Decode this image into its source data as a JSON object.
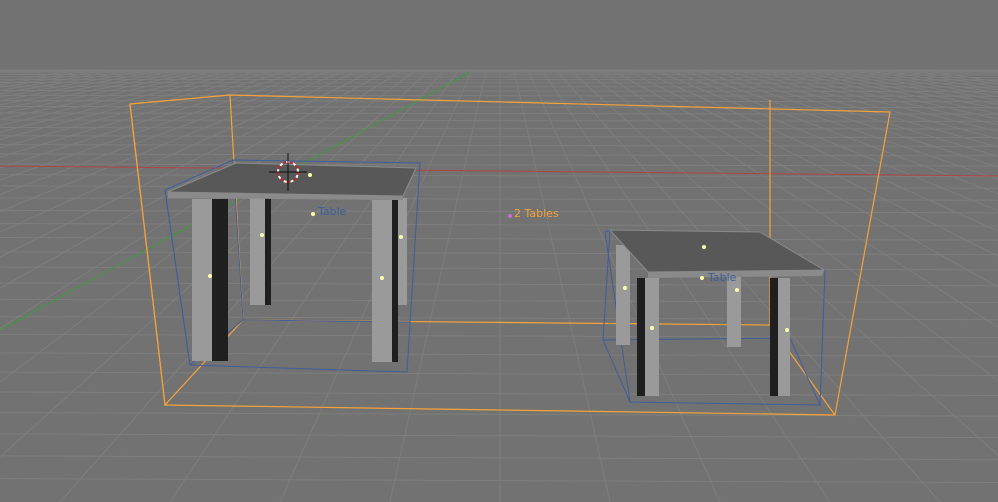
{
  "viewport": {
    "background": "#727272",
    "grid_color": "#7e7e7e",
    "x_axis_color": "#b04545",
    "y_axis_color": "#3f9a3f"
  },
  "selection": {
    "group_label": "2 Tables",
    "group_color": "#f5a23a"
  },
  "objects": [
    {
      "label": "Table",
      "bbox_color": "#3f5e9a"
    },
    {
      "label": "Table",
      "bbox_color": "#3f5e9a"
    }
  ],
  "colors": {
    "table_top": "#585858",
    "table_edge": "#8a8a8a",
    "leg_light": "#9a9a9a",
    "leg_dark": "#1f1f1f",
    "pivot_dot": "#ffffb0",
    "cursor_ring": "#cc2222"
  }
}
